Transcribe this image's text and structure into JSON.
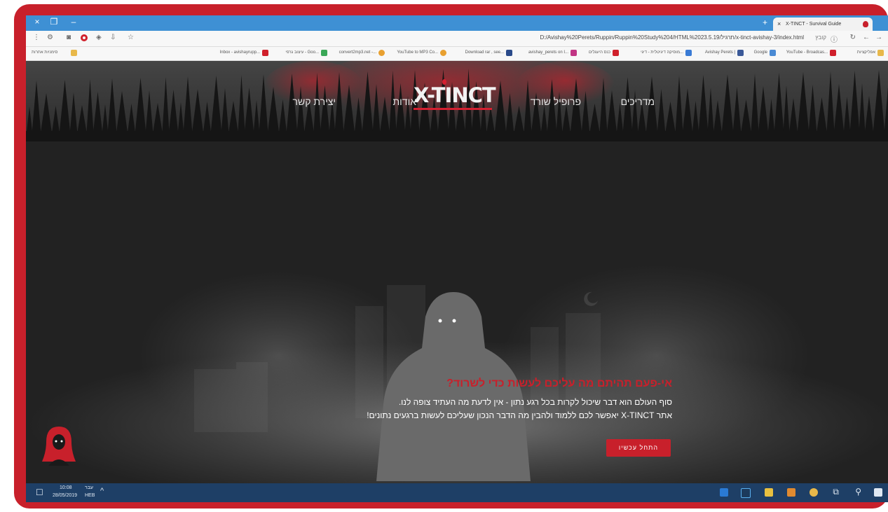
{
  "window": {
    "controls": [
      "×",
      "❐",
      "–"
    ],
    "tab_title": "X-TINCT - Survival Guide",
    "tab_close": "×",
    "new_tab": "+"
  },
  "addressbar": {
    "url": "D:/Avishay%20Perets/Ruppin/Ruppin%20Study%204/HTML%2023.5.19/תרגיל/x-tinct-avishay-3/index.html",
    "file_label": "קובץ",
    "icons": [
      "menu-dots-icon",
      "extension-icon",
      "camera-icon",
      "opera-icon",
      "shield-icon",
      "download-icon",
      "star-icon",
      "info-icon",
      "reload-icon",
      "back-icon",
      "forward-icon"
    ]
  },
  "bookmarks": [
    {
      "label": "אפליקציות",
      "color": "#e8b84a"
    },
    {
      "label": "YouTube - Broadcas...",
      "color": "#d0202b"
    },
    {
      "label": "Google",
      "color": "#4a8ad4"
    },
    {
      "label": "Avishay Perets |",
      "color": "#3b5998"
    },
    {
      "label": "מוסיקה דיגיטלית - דיגי...",
      "color": "#3a7bd5"
    },
    {
      "label": "כנס היעגלים",
      "color": "#d0202b"
    },
    {
      "label": "avishay_perets on I...",
      "color": "#c13584"
    },
    {
      "label": "Download rar , see...",
      "color": "#2a4a8a"
    },
    {
      "label": "YouTube to MP3 Co...",
      "color": "#e8a030"
    },
    {
      "label": "convert2mp3.net -...",
      "color": "#e8a030"
    },
    {
      "label": "עיצוב גרפי - Goo...",
      "color": "#3aa757"
    },
    {
      "label": "Inbox - avishayrupp...",
      "color": "#d0202b"
    },
    {
      "label": "סימניות אחרות",
      "color": "#e8b84a"
    }
  ],
  "site": {
    "nav": {
      "guides": "מדריכים",
      "survivor_profile": "פרופיל שורד",
      "logo": "X-TINCT",
      "about": "אודות",
      "contact": "יצירת קשר"
    },
    "hero": {
      "title": "אי-פעם תהיתם מה עליכם לעשות כדי לשרוד?",
      "line1": "סוף העולם הוא דבר שיכול לקרות בכל רגע נתון - אין לדעת מה העתיד צופה לנו.",
      "line2": "אתר X-TINCT יאפשר לכם ללמוד ולהבין מה הדבר הנכון שעליכם לעשות ברגעים נתונים!",
      "cta": "התחל עכשיו"
    }
  },
  "taskbar": {
    "time": "10:08",
    "date": "28/05/2019",
    "lang_top": "עבר",
    "lang_bottom": "HEB",
    "icons": [
      "windows-start-icon",
      "search-icon",
      "task-view-icon",
      "chrome-icon",
      "media-player-icon",
      "file-explorer-icon",
      "photoshop-icon",
      "store-icon"
    ]
  },
  "colors": {
    "brand_red": "#c8202b",
    "taskbar": "#1e3f66",
    "titlebar": "#3e90d4"
  }
}
